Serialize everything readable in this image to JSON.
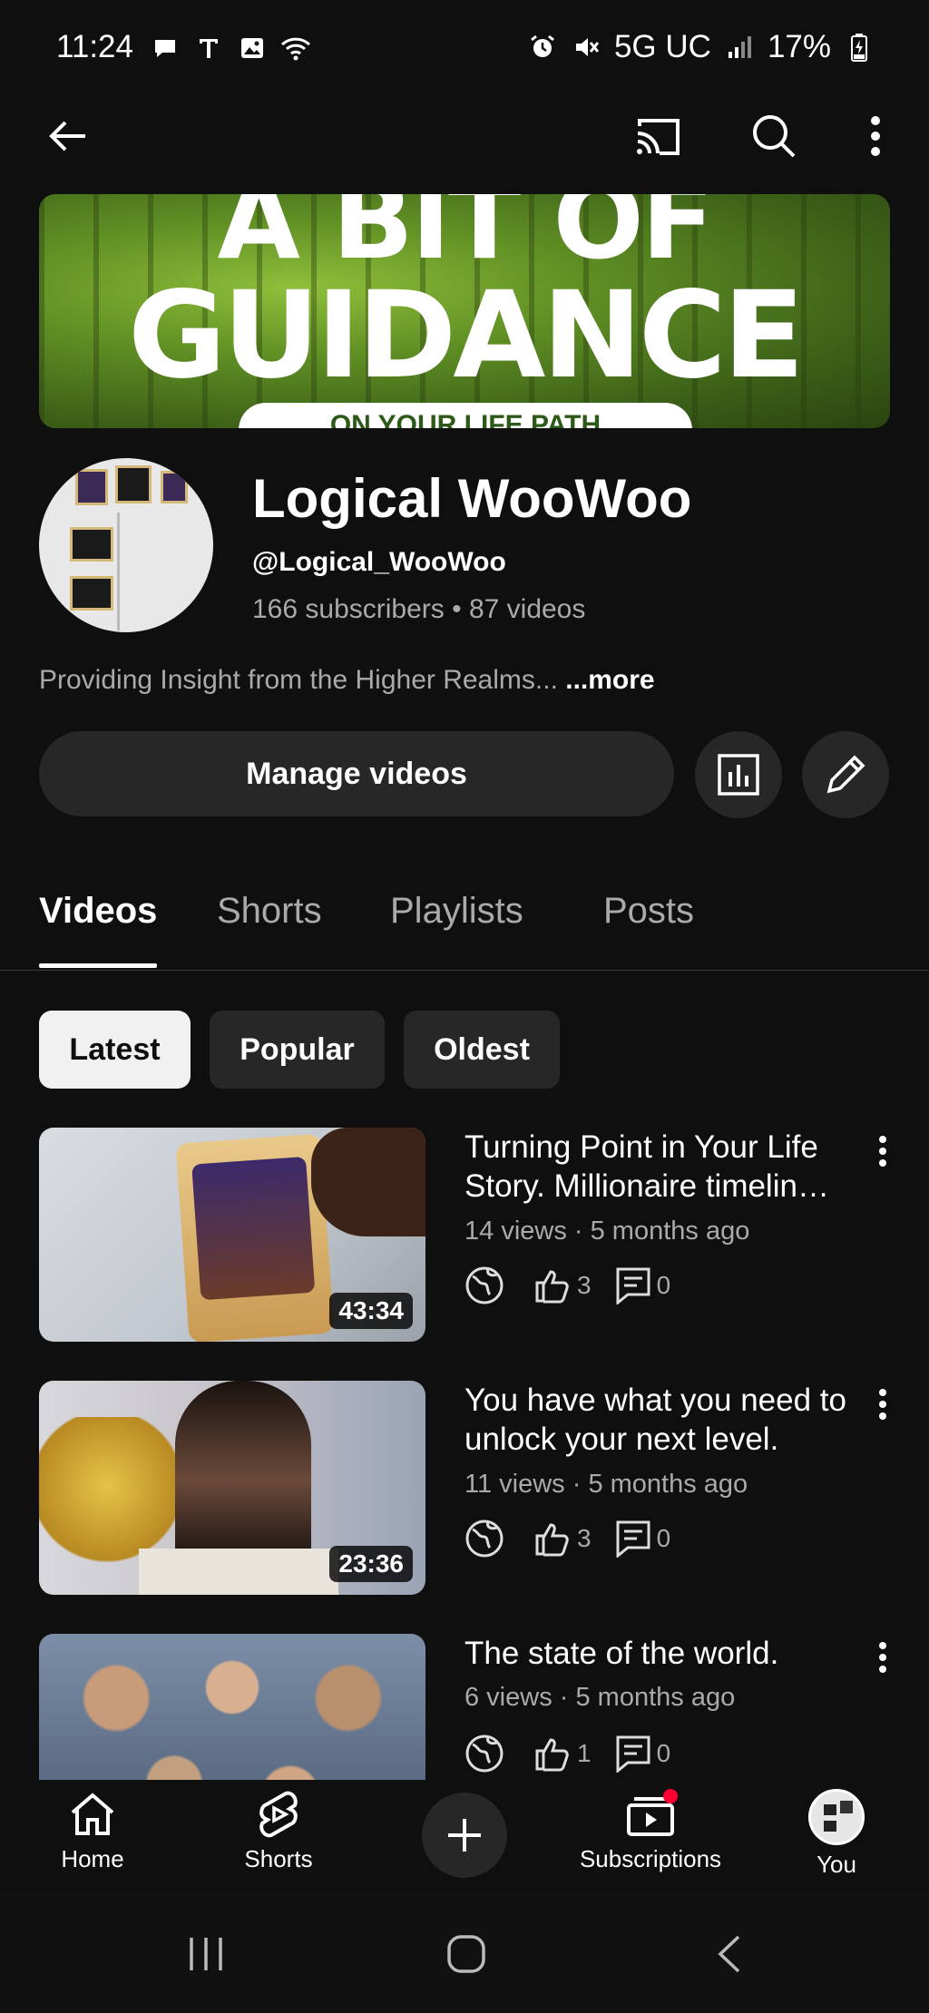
{
  "status_bar": {
    "time": "11:24",
    "network": "5G UC",
    "battery": "17%"
  },
  "app_bar": {
    "back_icon": "arrow-left-icon",
    "cast_icon": "cast-icon",
    "search_icon": "search-icon",
    "more_icon": "more-vert-icon"
  },
  "banner": {
    "line1": "A BIT OF",
    "line2": "GUIDANCE",
    "line3": "ON YOUR LIFE PATH"
  },
  "channel": {
    "name": "Logical WooWoo",
    "handle": "@Logical_WooWoo",
    "stats": "166 subscribers • 87 videos",
    "description": "Providing Insight from the Higher Realms...",
    "more_label": "...more",
    "manage_label": "Manage videos"
  },
  "tabs": [
    {
      "label": "Videos",
      "active": true
    },
    {
      "label": "Shorts",
      "active": false
    },
    {
      "label": "Playlists",
      "active": false
    },
    {
      "label": "Posts",
      "active": false
    }
  ],
  "chips": [
    {
      "label": "Latest",
      "selected": true
    },
    {
      "label": "Popular",
      "selected": false
    },
    {
      "label": "Oldest",
      "selected": false
    }
  ],
  "videos": [
    {
      "title": "Turning Point in Your Life Story. Millionaire timelin…",
      "meta": "14 views · 5 months ago",
      "duration": "43:34",
      "likes": "3",
      "comments": "0"
    },
    {
      "title": "You have what you need to unlock your next level.",
      "meta": "11 views · 5 months ago",
      "duration": "23:36",
      "likes": "3",
      "comments": "0"
    },
    {
      "title": "The state of the world.",
      "meta": "6 views · 5 months ago",
      "duration": "",
      "likes": "1",
      "comments": "0"
    }
  ],
  "bottom_nav": {
    "home": "Home",
    "shorts": "Shorts",
    "subscriptions": "Subscriptions",
    "you": "You"
  },
  "colors": {
    "background": "#0f0f0f",
    "surface": "#272727",
    "secondary_text": "#aaaaaa",
    "notification_dot": "#ff0033"
  }
}
